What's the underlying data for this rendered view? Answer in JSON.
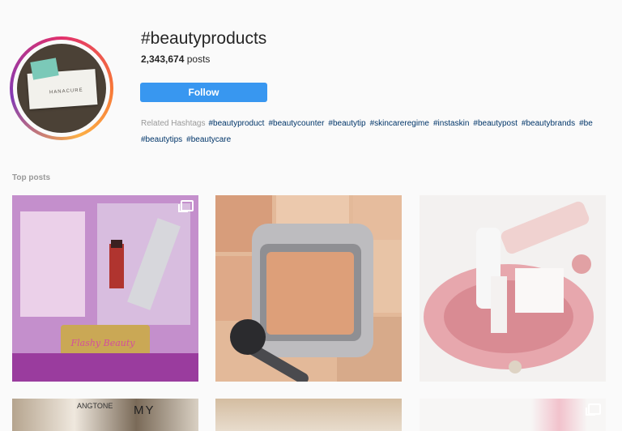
{
  "header": {
    "title": "#beautyproducts",
    "post_count": "2,343,674",
    "post_count_suffix": " posts",
    "follow_label": "Follow",
    "avatar_brand_text": "HANACURE"
  },
  "related": {
    "label": "Related Hashtags",
    "tags": [
      "#beautyproduct",
      "#beautycounter",
      "#beautytip",
      "#skincareregime",
      "#instaskin",
      "#beautypost",
      "#beautybrands",
      "#be",
      "#beautytips",
      "#beautycare"
    ]
  },
  "top_posts": {
    "label": "Top posts",
    "post1_text": "Flashy Beauty",
    "post4_text": "ANGTONE",
    "post4_text2": "MY"
  },
  "colors": {
    "follow_button": "#3897f0",
    "hashtag_link": "#003569"
  }
}
